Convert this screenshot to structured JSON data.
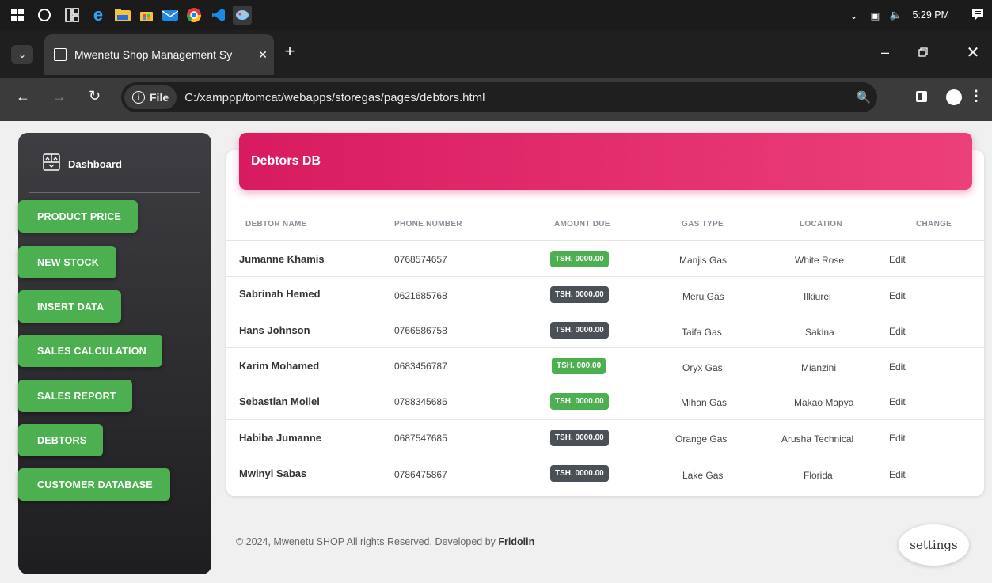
{
  "taskbar": {
    "time": "5:29 PM"
  },
  "browser": {
    "tab_title": "Mwenetu Shop Management Sy",
    "new_tab": "+",
    "file_label": "File",
    "url": "C:/xamppp/tomcat/webapps/storegas/pages/debtors.html"
  },
  "sidebar": {
    "brand": "Dashboard",
    "items": [
      {
        "label": "PRODUCT PRICE"
      },
      {
        "label": "NEW STOCK"
      },
      {
        "label": "INSERT DATA"
      },
      {
        "label": "SALES CALCULATION"
      },
      {
        "label": "SALES REPORT"
      },
      {
        "label": "DEBTORS"
      },
      {
        "label": "CUSTOMER DATABASE"
      }
    ]
  },
  "main": {
    "title": "Debtors DB",
    "columns": [
      "DEBTOR NAME",
      "PHONE NUMBER",
      "AMOUNT DUE",
      "GAS TYPE",
      "LOCATION",
      "CHANGE"
    ],
    "rows": [
      {
        "name": "Jumanne Khamis",
        "phone": "0768574657",
        "amount": "TSH. 0000.00",
        "status": "green",
        "gas": "Manjis Gas",
        "location": "White Rose",
        "action": "Edit"
      },
      {
        "name": "Sabrinah Hemed",
        "phone": "0621685768",
        "amount": "TSH. 0000.00",
        "status": "dark",
        "gas": "Meru Gas",
        "location": "Ilkiurei",
        "action": "Edit"
      },
      {
        "name": "Hans Johnson",
        "phone": "0766586758",
        "amount": "TSH. 0000.00",
        "status": "dark",
        "gas": "Taifa Gas",
        "location": "Sakina",
        "action": "Edit"
      },
      {
        "name": "Karim Mohamed",
        "phone": "0683456787",
        "amount": "TSH. 000.00",
        "status": "green",
        "gas": "Oryx Gas",
        "location": "Mianzini",
        "action": "Edit"
      },
      {
        "name": "Sebastian Mollel",
        "phone": "0788345686",
        "amount": "TSH. 0000.00",
        "status": "green",
        "gas": "Mihan Gas",
        "location": "Makao Mapya",
        "action": "Edit"
      },
      {
        "name": "Habiba Jumanne",
        "phone": "0687547685",
        "amount": "TSH. 0000.00",
        "status": "dark",
        "gas": "Orange Gas",
        "location": "Arusha Technical",
        "action": "Edit"
      },
      {
        "name": "Mwinyi Sabas",
        "phone": "0786475867",
        "amount": "TSH. 0000.00",
        "status": "dark",
        "gas": "Lake Gas",
        "location": "Florida",
        "action": "Edit"
      }
    ]
  },
  "footer": {
    "text": "© 2024, Mwenetu SHOP All rights Reserved. Developed by ",
    "author": "Fridolin"
  },
  "settings_label": "settings",
  "colors": {
    "accent": "#e91e63",
    "nav_button": "#4caf50",
    "badge_green": "#4caf50",
    "badge_dark": "#495057"
  }
}
